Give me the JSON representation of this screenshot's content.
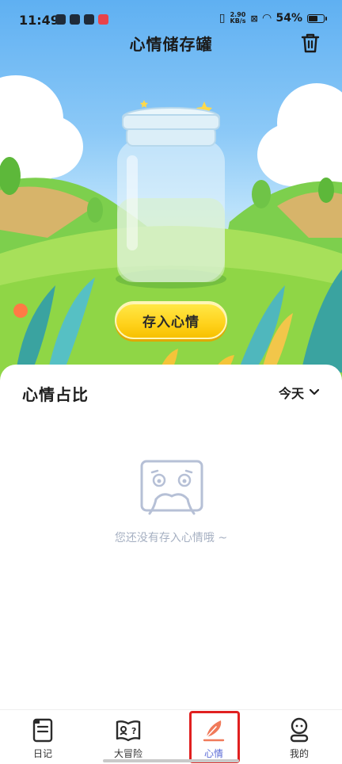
{
  "status": {
    "time": "11:49",
    "net_speed": [
      "2.90",
      "KB/s"
    ],
    "battery": "54%"
  },
  "header": {
    "title": "心情储存罐"
  },
  "hero": {
    "store_button_label": "存入心情"
  },
  "card": {
    "title": "心情占比",
    "period": "今天",
    "empty_text": "您还没有存入心情哦 ~"
  },
  "nav": {
    "items": [
      {
        "label": "日记",
        "icon": "diary-icon"
      },
      {
        "label": "大冒险",
        "icon": "adventure-icon"
      },
      {
        "label": "心情",
        "icon": "feather-icon",
        "active": true
      },
      {
        "label": "我的",
        "icon": "profile-icon"
      }
    ]
  },
  "colors": {
    "accent": "#ffd21c",
    "active_nav": "#5b6bd6",
    "highlight": "#e02020"
  }
}
